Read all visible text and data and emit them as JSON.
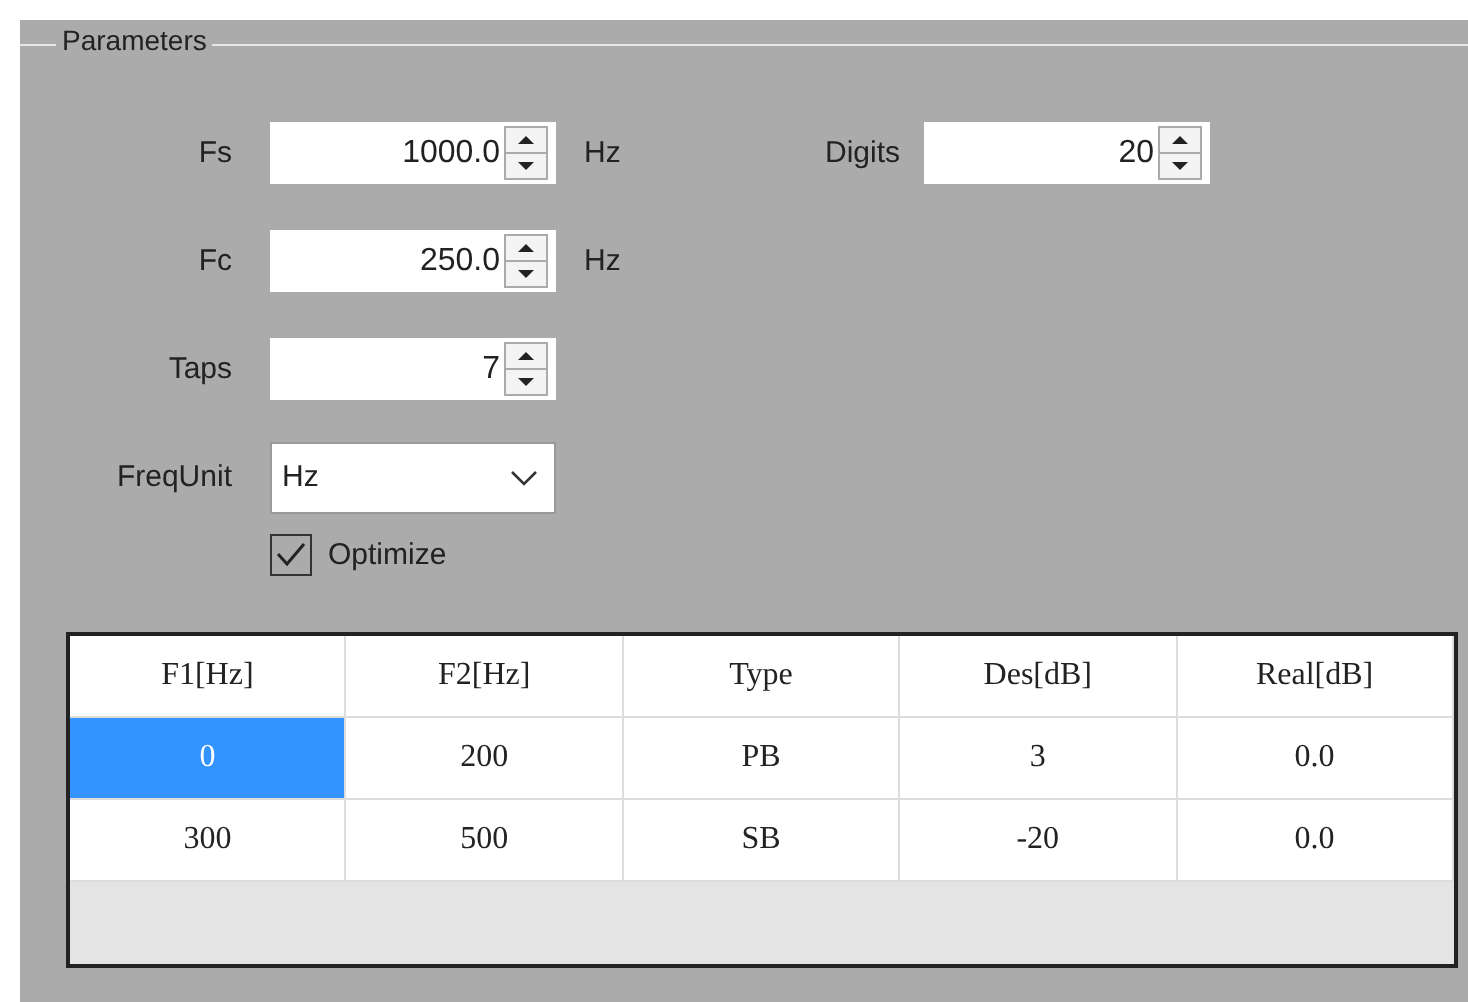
{
  "group": {
    "title": "Parameters"
  },
  "spinners": [
    {
      "label": "Fs",
      "value": "1000.0",
      "unit": "Hz"
    },
    {
      "label": "Fc",
      "value": "250.0",
      "unit": "Hz"
    },
    {
      "label": "Taps",
      "value": "7"
    }
  ],
  "digits": {
    "label": "Digits",
    "value": "20"
  },
  "freq_unit": {
    "label": "FreqUnit",
    "value": "Hz"
  },
  "optimize": {
    "label": "Optimize",
    "checked": true
  },
  "table": {
    "columns": [
      "F1[Hz]",
      "F2[Hz]",
      "Type",
      "Des[dB]",
      "Real[dB]"
    ],
    "rows": [
      {
        "cells": [
          {
            "text": "0",
            "selected": true
          },
          {
            "text": "200",
            "selected": false
          },
          {
            "text": "PB",
            "selected": false
          },
          {
            "text": "3",
            "selected": false
          },
          {
            "text": "0.0",
            "selected": false
          }
        ]
      },
      {
        "cells": [
          {
            "text": "300",
            "selected": false
          },
          {
            "text": "500",
            "selected": false
          },
          {
            "text": "SB",
            "selected": false
          },
          {
            "text": "-20",
            "selected": false
          },
          {
            "text": "0.0",
            "selected": false
          }
        ]
      }
    ]
  }
}
